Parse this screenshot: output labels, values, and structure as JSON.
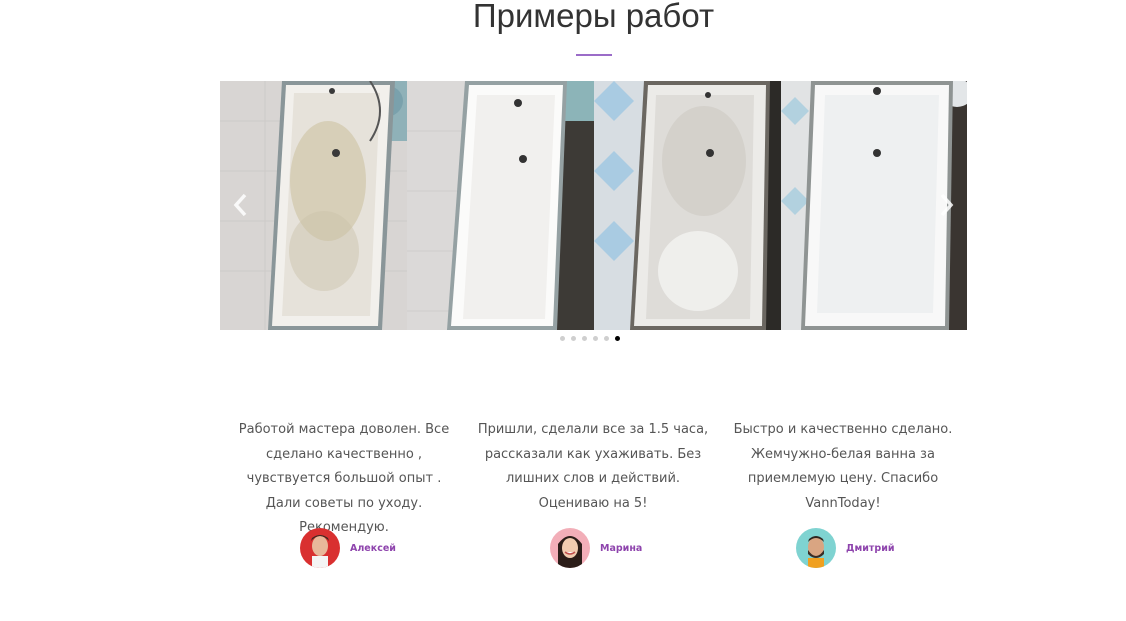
{
  "section": {
    "title": "Примеры работ"
  },
  "slider": {
    "slide_count": 6,
    "active_slide": 6,
    "slides": [
      {
        "name": "bathtub-before-1"
      },
      {
        "name": "bathtub-after-1"
      },
      {
        "name": "bathtub-before-2"
      },
      {
        "name": "bathtub-after-2"
      }
    ],
    "prev_icon": "chevron-left-icon",
    "next_icon": "chevron-right-icon"
  },
  "reviews": [
    {
      "text": "Работой мастера доволен. Все сделано качественно , чувствуется большой опыт . Дали советы по уходу. Рекомендую.",
      "author": "Алексей",
      "avatar_bg": "#d93030"
    },
    {
      "text": "Пришли, сделали все за 1.5 часа, рассказали как ухаживать. Без лишних слов и действий. Оцениваю на 5!",
      "author": "Марина",
      "avatar_bg": "#f2aeb8"
    },
    {
      "text": "Быстро и качественно сделано. Жемчужно-белая ванна за приемлемую цену. Спасибо VannToday!",
      "author": "Дмитрий",
      "avatar_bg": "#7fd3d1"
    }
  ],
  "colors": {
    "accent": "#9b6cc8",
    "author_name": "#8e44ad",
    "text": "#555555",
    "heading": "#333333"
  }
}
